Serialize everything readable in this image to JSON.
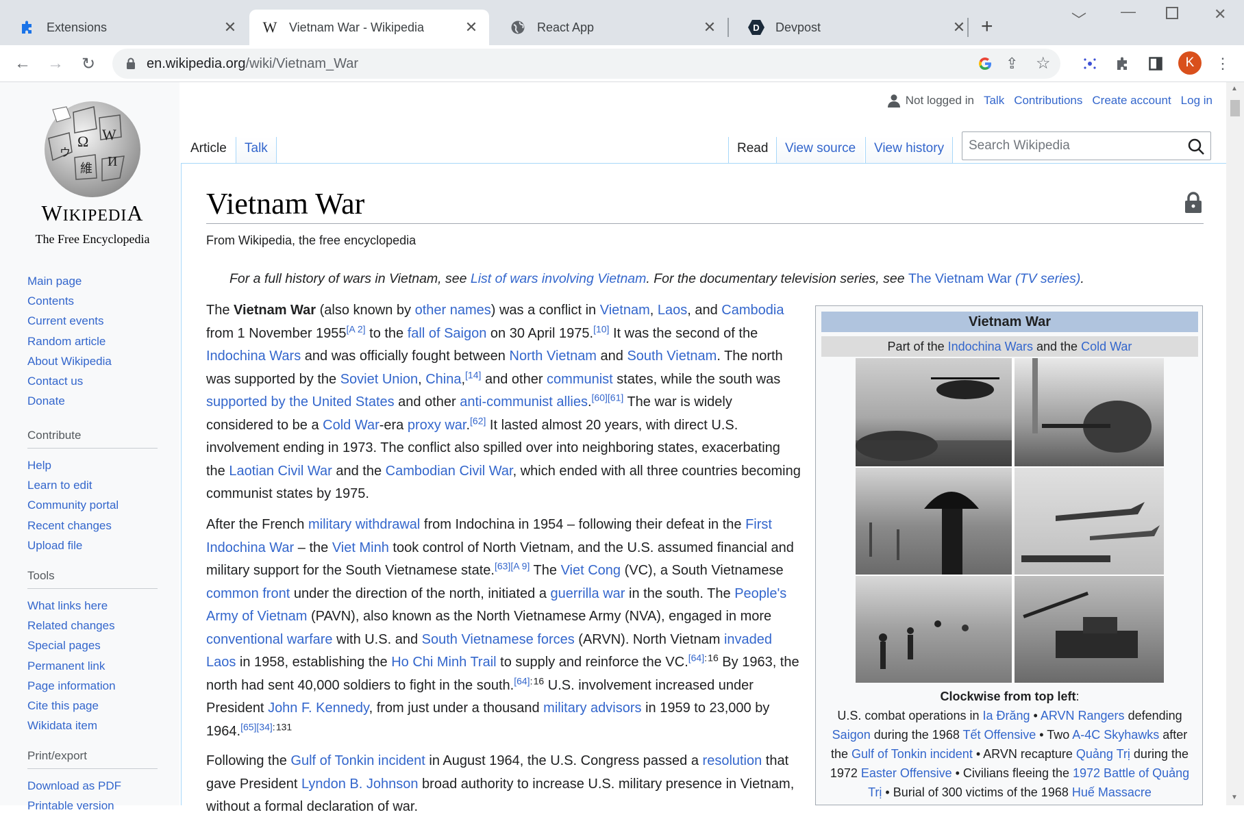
{
  "browser": {
    "tabs": [
      {
        "title": "Extensions",
        "icon": "puzzle-icon"
      },
      {
        "title": "Vietnam War - Wikipedia",
        "icon": "wikipedia-w-icon"
      },
      {
        "title": "React App",
        "icon": "globe-icon"
      },
      {
        "title": "Devpost",
        "icon": "devpost-icon"
      }
    ],
    "url_host": "en.wikipedia.org",
    "url_path": "/wiki/Vietnam_War",
    "avatar_letter": "K",
    "accent_color": "#d9501c"
  },
  "personal": {
    "not_logged_in": "Not logged in",
    "talk": "Talk",
    "contributions": "Contributions",
    "create_account": "Create account",
    "log_in": "Log in"
  },
  "tabs": {
    "article": "Article",
    "talk": "Talk",
    "read": "Read",
    "view_source": "View source",
    "view_history": "View history"
  },
  "search": {
    "placeholder": "Search Wikipedia"
  },
  "logo": {
    "wordmark": "Wikipedia",
    "tagline": "The Free Encyclopedia"
  },
  "sidebar": {
    "main": [
      "Main page",
      "Contents",
      "Current events",
      "Random article",
      "About Wikipedia",
      "Contact us",
      "Donate"
    ],
    "contribute_header": "Contribute",
    "contribute": [
      "Help",
      "Learn to edit",
      "Community portal",
      "Recent changes",
      "Upload file"
    ],
    "tools_header": "Tools",
    "tools": [
      "What links here",
      "Related changes",
      "Special pages",
      "Permanent link",
      "Page information",
      "Cite this page",
      "Wikidata item"
    ],
    "print_header": "Print/export",
    "print": [
      "Download as PDF",
      "Printable version"
    ]
  },
  "article": {
    "title": "Vietnam War",
    "from": "From Wikipedia, the free encyclopedia",
    "hatnote_pre": "For a full history of wars in Vietnam, see ",
    "hatnote_link1": "List of wars involving Vietnam",
    "hatnote_mid": ". For the documentary television series, see ",
    "hatnote_link2": "The Vietnam War",
    "hatnote_link2b": " (TV series)",
    "hatnote_post": "."
  },
  "infobox": {
    "title": "Vietnam War",
    "sub_pre": "Part of the ",
    "sub_link1": "Indochina Wars",
    "sub_mid": " and the ",
    "sub_link2": "Cold War",
    "caption_head": "Clockwise from top left",
    "caption_colon": ":"
  }
}
